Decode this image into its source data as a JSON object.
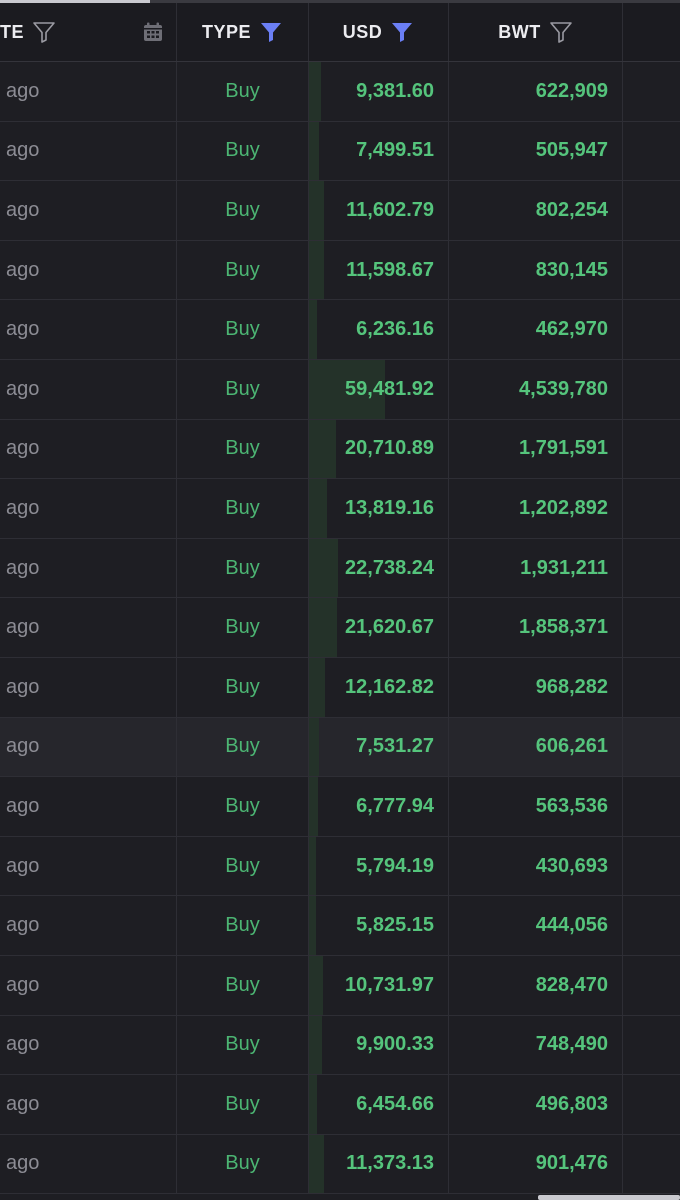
{
  "header": {
    "date_label": "TE",
    "type_label": "TYPE",
    "usd_label": "USD",
    "bwt_label": "BWT",
    "date_filter_icon": "filter-outline-icon",
    "calendar_icon": "calendar-icon",
    "type_filter_icon": "filter-active-icon",
    "usd_filter_icon": "filter-active-icon",
    "bwt_filter_icon": "filter-outline-icon"
  },
  "colors": {
    "background": "#1e1e23",
    "buy_green": "#4cb573",
    "value_green": "#55c47c",
    "filter_active": "#6b7ff5",
    "muted_text": "#8c8c94"
  },
  "rows": [
    {
      "date": "ago",
      "type": "Buy",
      "usd": "9,381.60",
      "bwt": "622,909"
    },
    {
      "date": "ago",
      "type": "Buy",
      "usd": "7,499.51",
      "bwt": "505,947"
    },
    {
      "date": "ago",
      "type": "Buy",
      "usd": "11,602.79",
      "bwt": "802,254"
    },
    {
      "date": "ago",
      "type": "Buy",
      "usd": "11,598.67",
      "bwt": "830,145"
    },
    {
      "date": "ago",
      "type": "Buy",
      "usd": "6,236.16",
      "bwt": "462,970"
    },
    {
      "date": "ago",
      "type": "Buy",
      "usd": "59,481.92",
      "bwt": "4,539,780"
    },
    {
      "date": "ago",
      "type": "Buy",
      "usd": "20,710.89",
      "bwt": "1,791,591"
    },
    {
      "date": "ago",
      "type": "Buy",
      "usd": "13,819.16",
      "bwt": "1,202,892"
    },
    {
      "date": "ago",
      "type": "Buy",
      "usd": "22,738.24",
      "bwt": "1,931,211"
    },
    {
      "date": "ago",
      "type": "Buy",
      "usd": "21,620.67",
      "bwt": "1,858,371"
    },
    {
      "date": "ago",
      "type": "Buy",
      "usd": "12,162.82",
      "bwt": "968,282"
    },
    {
      "date": "ago",
      "type": "Buy",
      "usd": "7,531.27",
      "bwt": "606,261"
    },
    {
      "date": "ago",
      "type": "Buy",
      "usd": "6,777.94",
      "bwt": "563,536"
    },
    {
      "date": "ago",
      "type": "Buy",
      "usd": "5,794.19",
      "bwt": "430,693"
    },
    {
      "date": "ago",
      "type": "Buy",
      "usd": "5,825.15",
      "bwt": "444,056"
    },
    {
      "date": "ago",
      "type": "Buy",
      "usd": "10,731.97",
      "bwt": "828,470"
    },
    {
      "date": "ago",
      "type": "Buy",
      "usd": "9,900.33",
      "bwt": "748,490"
    },
    {
      "date": "ago",
      "type": "Buy",
      "usd": "6,454.66",
      "bwt": "496,803"
    },
    {
      "date": "ago",
      "type": "Buy",
      "usd": "11,373.13",
      "bwt": "901,476"
    }
  ]
}
